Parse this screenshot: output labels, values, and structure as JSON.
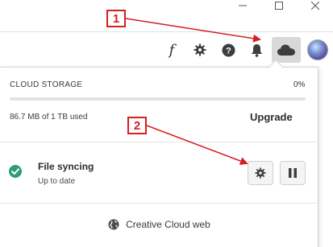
{
  "window": {
    "minimize_icon": "minimize-icon",
    "maximize_icon": "maximize-icon",
    "close_icon": "close-icon"
  },
  "toolbar": {
    "icons": [
      "fonts-icon",
      "gear-icon",
      "help-icon",
      "bell-icon",
      "cloud-icon"
    ],
    "fonts_glyph": "f",
    "active": "cloud-icon"
  },
  "storage": {
    "label": "CLOUD STORAGE",
    "percent_text": "0%",
    "percent_value": 0,
    "used_text": "86.7 MB of 1 TB used",
    "upgrade_label": "Upgrade"
  },
  "sync": {
    "title": "File syncing",
    "status": "Up to date",
    "status_color": "#2d9d78"
  },
  "footer": {
    "link_label": "Creative Cloud web"
  },
  "annotations": {
    "callout_1": "1",
    "callout_2": "2",
    "color": "#d61f1f"
  },
  "colors": {
    "accent": "#1473e6"
  }
}
